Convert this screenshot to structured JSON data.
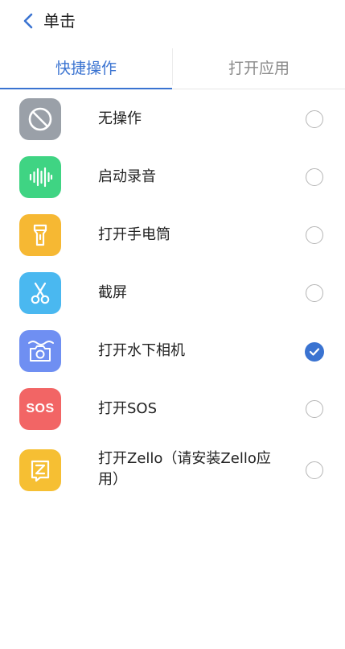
{
  "header": {
    "title": "单击"
  },
  "tabs": [
    {
      "label": "快捷操作",
      "active": true
    },
    {
      "label": "打开应用",
      "active": false
    }
  ],
  "options": [
    {
      "label": "无操作",
      "icon": "no-action-icon",
      "color": "#9aa0a8",
      "selected": false
    },
    {
      "label": "启动录音",
      "icon": "voice-wave-icon",
      "color": "#3fd483",
      "selected": false
    },
    {
      "label": "打开手电筒",
      "icon": "flashlight-icon",
      "color": "#f6b833",
      "selected": false
    },
    {
      "label": "截屏",
      "icon": "scissors-icon",
      "color": "#4ab8f0",
      "selected": false
    },
    {
      "label": "打开水下相机",
      "icon": "underwater-camera-icon",
      "color": "#6f8ff2",
      "selected": true
    },
    {
      "label": "打开SOS",
      "icon": "sos-icon",
      "icon_text": "SOS",
      "color": "#f26565",
      "selected": false
    },
    {
      "label": "打开Zello（请安装Zello应用）",
      "icon": "zello-icon",
      "color": "#f6bf33",
      "selected": false
    }
  ],
  "accent_color": "#3a73d1"
}
